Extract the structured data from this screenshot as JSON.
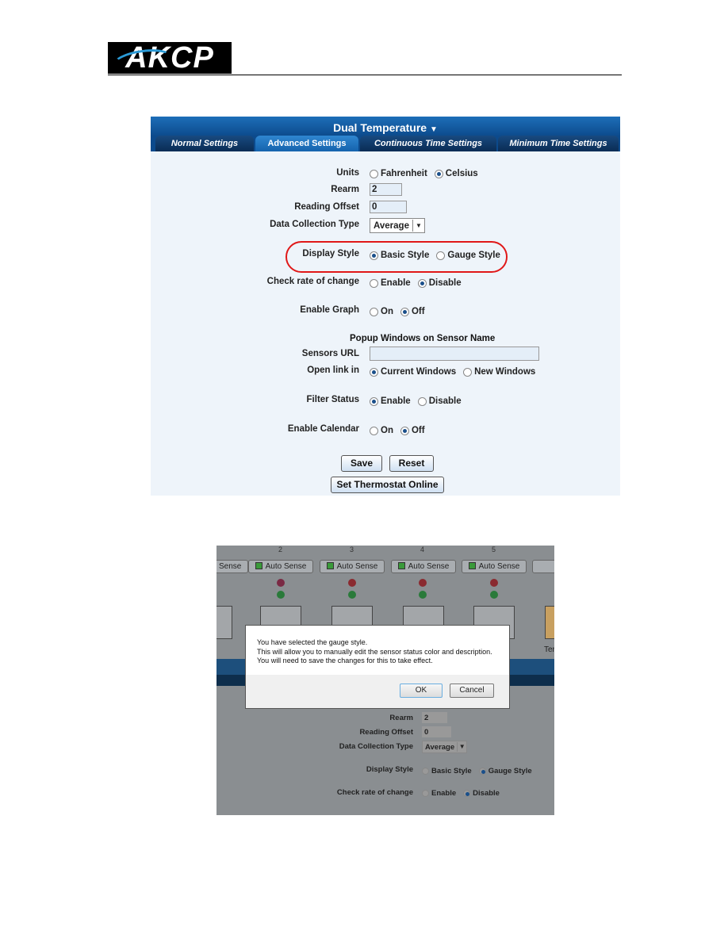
{
  "logo": {
    "text": "AKCP"
  },
  "settings": {
    "title": "Dual Temperature",
    "title_arrow": "▼",
    "tabs": [
      "Normal Settings",
      "Advanced Settings",
      "Continuous Time Settings",
      "Minimum Time Settings"
    ],
    "active_tab": "Advanced Settings",
    "units": {
      "label": "Units",
      "options": [
        "Fahrenheit",
        "Celsius"
      ],
      "selected": "Celsius"
    },
    "rearm": {
      "label": "Rearm",
      "value": "2"
    },
    "reading_offset": {
      "label": "Reading Offset",
      "value": "0"
    },
    "data_collection": {
      "label": "Data Collection Type",
      "value": "Average"
    },
    "display_style": {
      "label": "Display Style",
      "options": [
        "Basic Style",
        "Gauge Style"
      ],
      "selected": "Basic Style",
      "highlight_color": "#e01818"
    },
    "rate_of_change": {
      "label": "Check rate of change",
      "options": [
        "Enable",
        "Disable"
      ],
      "selected": "Disable"
    },
    "enable_graph": {
      "label": "Enable Graph",
      "options": [
        "On",
        "Off"
      ],
      "selected": "Off"
    },
    "popup_heading": "Popup Windows on Sensor Name",
    "sensors_url": {
      "label": "Sensors URL",
      "value": ""
    },
    "open_link": {
      "label": "Open link in",
      "options": [
        "Current Windows",
        "New Windows"
      ],
      "selected": "Current Windows"
    },
    "filter_status": {
      "label": "Filter Status",
      "options": [
        "Enable",
        "Disable"
      ],
      "selected": "Enable"
    },
    "enable_calendar": {
      "label": "Enable Calendar",
      "options": [
        "On",
        "Off"
      ],
      "selected": "Off"
    },
    "save": "Save",
    "reset": "Reset",
    "thermostat": "Set Thermostat Online"
  },
  "dialog_shot": {
    "sensor_numbers": [
      "2",
      "3",
      "4",
      "5"
    ],
    "auto_sense": "Auto Sense",
    "partial_label": "Ter",
    "message": [
      "You have selected the gauge style.",
      "This will allow you to manually edit the sensor status color and description.",
      "You will need to save the changes for this to take effect."
    ],
    "ok": "OK",
    "cancel": "Cancel",
    "rearm": {
      "label": "Rearm",
      "value": "2"
    },
    "reading_offset": {
      "label": "Reading Offset",
      "value": "0"
    },
    "data_collection": {
      "label": "Data Collection Type",
      "value": "Average"
    },
    "display_style": {
      "label": "Display Style",
      "options": [
        "Basic Style",
        "Gauge Style"
      ],
      "selected": "Gauge Style"
    },
    "rate_of_change": {
      "label": "Check rate of change",
      "options": [
        "Enable",
        "Disable"
      ],
      "selected": "Disable"
    }
  }
}
